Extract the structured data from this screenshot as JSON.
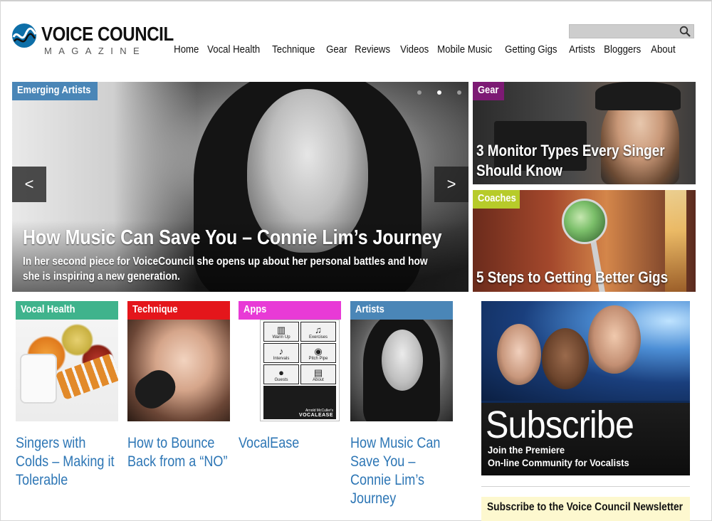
{
  "logo": {
    "title": "VOICE COUNCIL",
    "subtitle": "MAGAZINE",
    "brand_color": "#0e6fa8"
  },
  "search": {
    "icon": "search-icon",
    "placeholder": ""
  },
  "nav": {
    "items": [
      {
        "label": "Home"
      },
      {
        "label": "Vocal Health"
      },
      {
        "label": "Technique"
      },
      {
        "label": "Gear"
      },
      {
        "label": "Reviews"
      },
      {
        "label": "Videos"
      },
      {
        "label": "Mobile Music"
      },
      {
        "label": "Getting Gigs"
      },
      {
        "label": "Artists"
      },
      {
        "label": "Bloggers"
      },
      {
        "label": "About"
      }
    ]
  },
  "hero": {
    "tag": "Emerging Artists",
    "tag_color": "#4a86b7",
    "title": "How Music Can Save You – Connie Lim’s Journey",
    "description": "In her second piece for VoiceCouncil she opens up about her personal battles and how she is inspiring a new generation.",
    "prev_label": "<",
    "next_label": ">",
    "slide_count": 3,
    "active_slide": 2
  },
  "side_features": [
    {
      "tag": "Gear",
      "tag_color": "#7d1a74",
      "title_line1": "3 Monitor Types Every Singer",
      "title_line2": "Should Know"
    },
    {
      "tag": "Coaches",
      "tag_color": "#b7cb2a",
      "title_line1": "5 Steps to Getting Better Gigs"
    }
  ],
  "cards": [
    {
      "tag": "Vocal Health",
      "tag_color": "#3fb38c",
      "title": "Singers with Colds – Making it Tolerable"
    },
    {
      "tag": "Technique",
      "tag_color": "#e4161b",
      "title": "How to Bounce Back from a “NO”"
    },
    {
      "tag": "Apps",
      "tag_color": "#e83ad6",
      "title": "VocalEase"
    },
    {
      "tag": "Artists",
      "tag_color": "#4a86b7",
      "title": "How Music Can Save You – Connie Lim’s Journey"
    }
  ],
  "app_screen": {
    "buttons": [
      {
        "label": "Warm Up",
        "icon": "piano-icon"
      },
      {
        "label": "Exercises",
        "icon": "music-note-icon"
      },
      {
        "label": "Intervals",
        "icon": "treble-clef-icon"
      },
      {
        "label": "Pitch Pipe",
        "icon": "pitch-pipe-icon"
      },
      {
        "label": "Guests",
        "icon": "person-icon"
      },
      {
        "label": "About",
        "icon": "info-icon"
      }
    ],
    "footer_credit": "Arnold McCuller's",
    "footer_brand": "VOCALEASE"
  },
  "subscribe": {
    "headline": "Subscribe",
    "line1": "Join the Premiere",
    "line2": "On-line Community for Vocalists"
  },
  "newsletter": {
    "title": "Subscribe to the Voice Council Newsletter"
  }
}
